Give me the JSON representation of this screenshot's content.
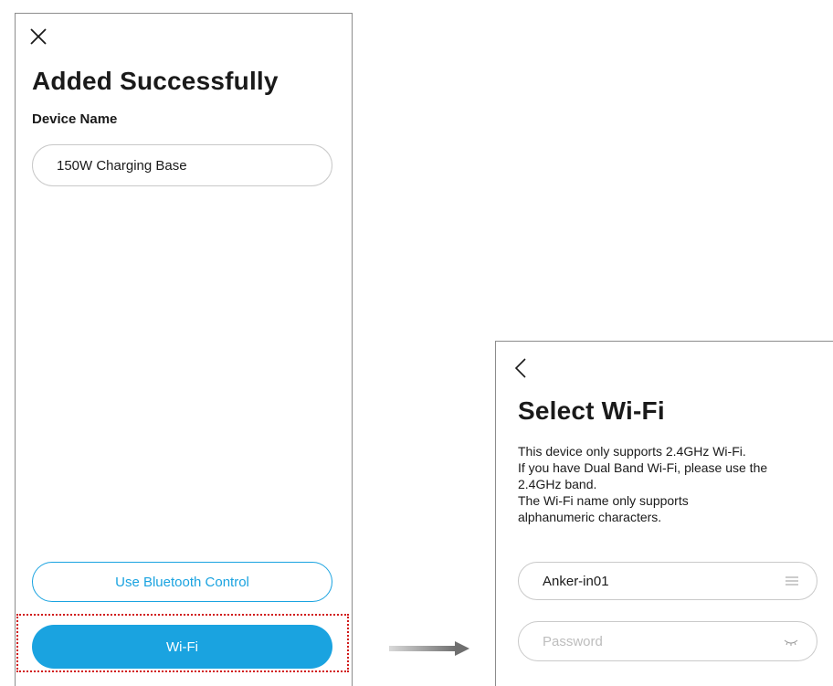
{
  "screen_added": {
    "title": "Added Successfully",
    "device_name_label": "Device Name",
    "device_name_value": "150W Charging Base",
    "bluetooth_button": "Use Bluetooth Control",
    "wifi_button": "Wi-Fi",
    "close_icon": "close-icon"
  },
  "screen_wifi": {
    "title": "Select Wi-Fi",
    "description_lines": [
      "This device only supports 2.4GHz Wi-Fi.",
      "If you have Dual Band Wi-Fi, please use the",
      "2.4GHz band.",
      "The Wi-Fi name only supports",
      "alphanumeric characters."
    ],
    "wifi_name_value": "Anker-in01",
    "password_placeholder": "Password",
    "back_icon": "chevron-left-icon",
    "list_icon": "list-icon",
    "eye_icon": "eye-closed-icon"
  },
  "colors": {
    "accent": "#1aa3e0",
    "highlight": "#d11a1a",
    "arrow": "#888888"
  }
}
